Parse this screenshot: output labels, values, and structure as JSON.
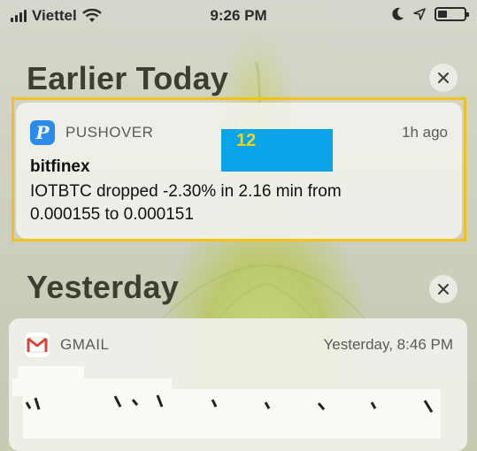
{
  "status_bar": {
    "carrier": "Viettel",
    "time": "9:26 PM"
  },
  "sections": {
    "earlier_today": "Earlier Today",
    "yesterday": "Yesterday"
  },
  "notifications": [
    {
      "app": "PUSHOVER",
      "time": "1h ago",
      "title": "bitfinex",
      "body_line1": "IOTBTC dropped -2.30% in 2.16 min from",
      "body_line2": "0.000155 to 0.000151",
      "icon": "pushover-icon",
      "icon_color": "#2a8be8"
    },
    {
      "app": "GMAIL",
      "time": "Yesterday, 8:46 PM",
      "icon": "gmail-icon",
      "icon_color": "#d9453a"
    }
  ],
  "overlay": {
    "label": "12",
    "border_color": "#f2c21b",
    "label_bg": "#0aa5e8"
  }
}
